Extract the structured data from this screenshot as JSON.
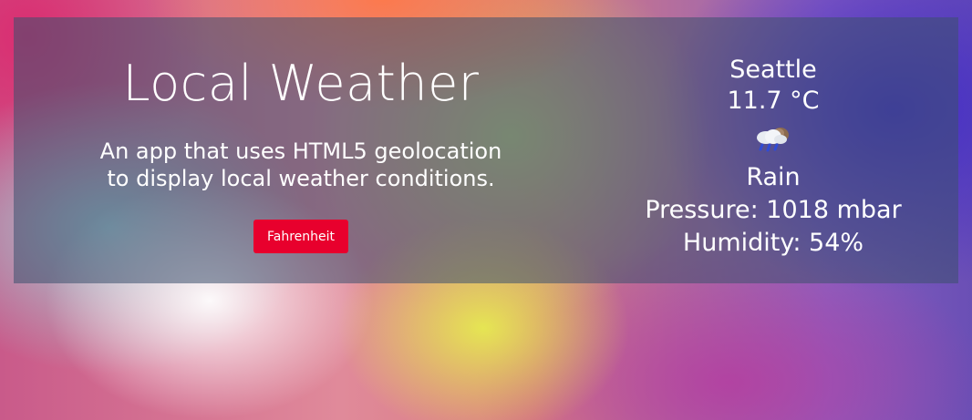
{
  "header": {
    "title": "Local Weather",
    "subtitle_line1": "An app that uses HTML5 geolocation",
    "subtitle_line2": "to display local weather conditions."
  },
  "controls": {
    "unit_button_label": "Fahrenheit"
  },
  "weather": {
    "city": "Seattle",
    "temperature": "11.7 °C",
    "icon": "rain-cloud-icon",
    "condition": "Rain",
    "pressure": "Pressure: 1018 mbar",
    "humidity": "Humidity: 54%"
  },
  "colors": {
    "button_bg": "#e8002d",
    "text": "#ffffff"
  }
}
